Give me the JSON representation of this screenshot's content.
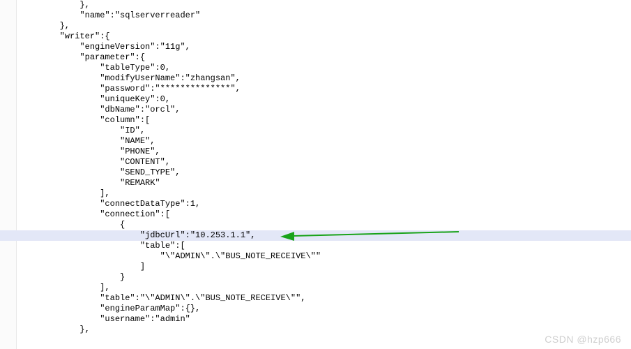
{
  "lines": [
    "            },",
    "            \"name\":\"sqlserverreader\"",
    "        },",
    "        \"writer\":{",
    "            \"engineVersion\":\"11g\",",
    "            \"parameter\":{",
    "                \"tableType\":0,",
    "                \"modifyUserName\":\"zhangsan\",",
    "                \"password\":\"**************\",",
    "                \"uniqueKey\":0,",
    "                \"dbName\":\"orcl\",",
    "                \"column\":[",
    "                    \"ID\",",
    "                    \"NAME\",",
    "                    \"PHONE\",",
    "                    \"CONTENT\",",
    "                    \"SEND_TYPE\",",
    "                    \"REMARK\"",
    "                ],",
    "                \"connectDataType\":1,",
    "                \"connection\":[",
    "                    {",
    "                        \"jdbcUrl\":\"10.253.1.1\",",
    "                        \"table\":[",
    "                            \"\\\"ADMIN\\\".\\\"BUS_NOTE_RECEIVE\\\"\"",
    "                        ]",
    "                    }",
    "                ],",
    "                \"table\":\"\\\"ADMIN\\\".\\\"BUS_NOTE_RECEIVE\\\"\",",
    "                \"engineParamMap\":{},",
    "                \"username\":\"admin\"",
    "            },"
  ],
  "highlight_index": 22,
  "watermark": "CSDN @hzp666",
  "chart_data": {
    "type": "table",
    "title": "JSON configuration snippet (DataX-style reader/writer)",
    "data": {
      "name": "sqlserverreader",
      "writer": {
        "engineVersion": "11g",
        "parameter": {
          "tableType": 0,
          "modifyUserName": "zhangsan",
          "password": "**************",
          "uniqueKey": 0,
          "dbName": "orcl",
          "column": [
            "ID",
            "NAME",
            "PHONE",
            "CONTENT",
            "SEND_TYPE",
            "REMARK"
          ],
          "connectDataType": 1,
          "connection": [
            {
              "jdbcUrl": "10.253.1.1",
              "table": [
                "\"ADMIN\".\"BUS_NOTE_RECEIVE\""
              ]
            }
          ],
          "table": "\"ADMIN\".\"BUS_NOTE_RECEIVE\"",
          "engineParamMap": {},
          "username": "admin"
        }
      }
    }
  }
}
